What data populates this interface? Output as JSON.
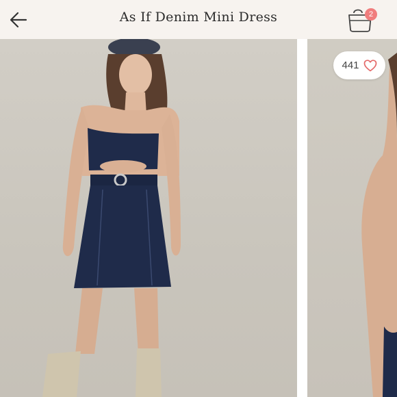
{
  "header": {
    "title": "As If Denim Mini Dress",
    "back_icon": "arrow-left-icon",
    "bag_icon": "shopping-bag-icon",
    "bag_count": "2"
  },
  "gallery": {
    "like_count": "441",
    "like_icon": "heart-outline-icon",
    "images": [
      {
        "subject": "model-front-view"
      },
      {
        "subject": "model-side-view"
      }
    ]
  },
  "colors": {
    "header_bg": "#f7f3ef",
    "badge": "#f07d7d",
    "heart": "#e46a6a",
    "denim": "#1f2b4a"
  }
}
